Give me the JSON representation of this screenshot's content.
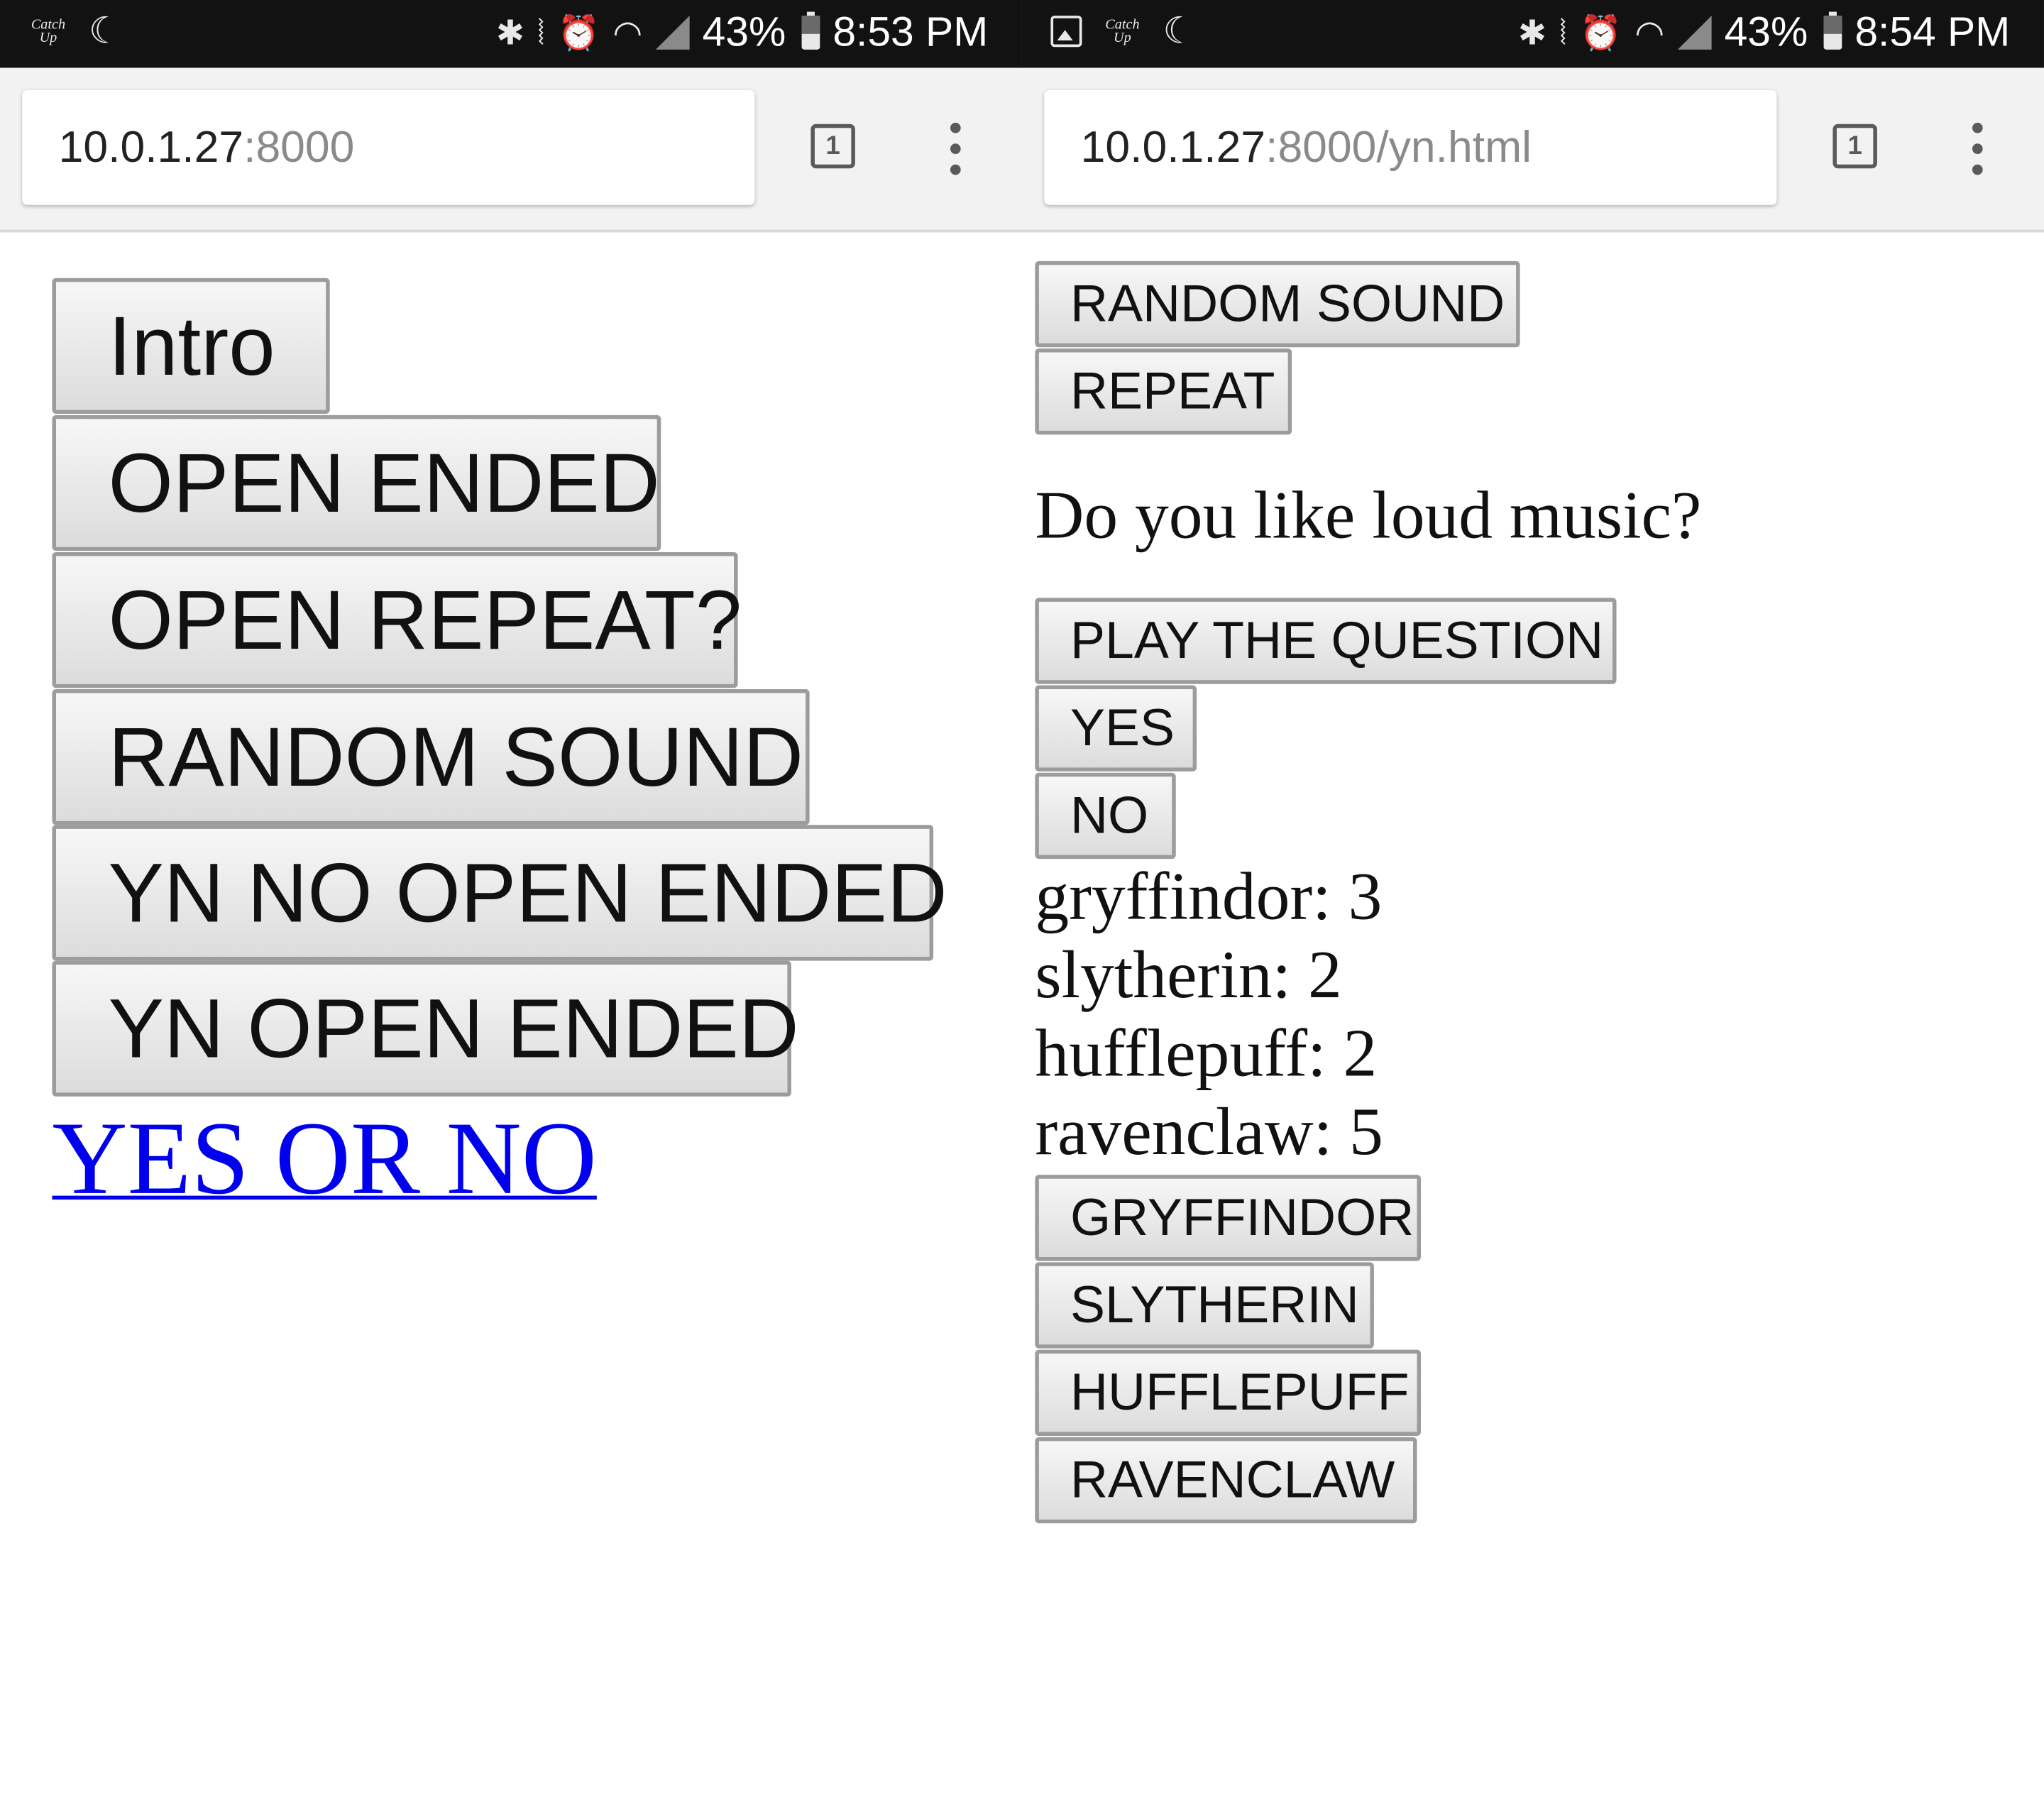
{
  "left": {
    "status": {
      "app_badge": "Catch Up",
      "battery": "43%",
      "time": "8:53 PM"
    },
    "url": {
      "host": "10.0.1.27",
      "path": ":8000"
    },
    "tab_count": "1",
    "buttons": [
      "Intro",
      "OPEN ENDED",
      "OPEN REPEAT?",
      "RANDOM SOUND",
      "YN NO OPEN ENDED",
      "YN OPEN ENDED"
    ],
    "link": "YES OR NO"
  },
  "right": {
    "status": {
      "app_badge": "Catch Up",
      "battery": "43%",
      "time": "8:54 PM"
    },
    "url": {
      "host": "10.0.1.27",
      "path": ":8000/yn.html"
    },
    "tab_count": "1",
    "top_buttons": [
      "RANDOM SOUND",
      "REPEAT"
    ],
    "question": "Do you like loud music?",
    "answer_buttons": [
      "PLAY THE QUESTION",
      "YES",
      "NO"
    ],
    "scores": [
      "gryffindor: 3",
      "slytherin: 2",
      "hufflepuff: 2",
      "ravenclaw: 5"
    ],
    "house_buttons": [
      "GRYFFINDOR",
      "SLYTHERIN",
      "HUFFLEPUFF",
      "RAVENCLAW"
    ]
  },
  "colors": {
    "link": "#0000ee",
    "status_bar": "#121212",
    "toolbar": "#f2f2f2"
  },
  "icons": [
    "bluetooth-icon",
    "vibrate-icon",
    "alarm-icon",
    "wifi-icon",
    "signal-icon",
    "battery-icon",
    "moon-icon",
    "gallery-icon",
    "tab-switcher-icon",
    "overflow-menu-icon"
  ]
}
